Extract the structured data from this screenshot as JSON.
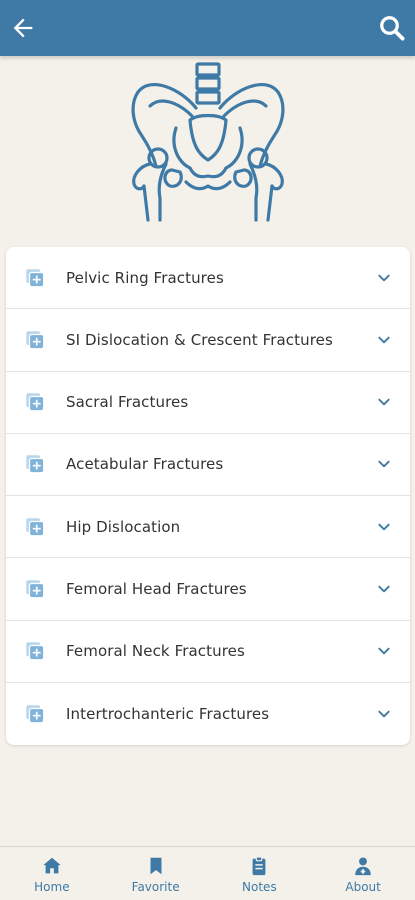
{
  "colors": {
    "primary": "#3f7aa6",
    "background": "#f4f1ea",
    "card": "#ffffff",
    "icon_light_blue": "#7fb3d9",
    "text": "#333333"
  },
  "topbar": {
    "back_icon": "arrow-left-icon",
    "search_icon": "search-icon"
  },
  "hero": {
    "icon": "pelvis-icon"
  },
  "sections": [
    {
      "label": "Pelvic Ring Fractures",
      "icon": "add-file-icon",
      "chevron": "chevron-down-icon"
    },
    {
      "label": "SI Dislocation & Crescent Fractures",
      "icon": "add-file-icon",
      "chevron": "chevron-down-icon"
    },
    {
      "label": "Sacral Fractures",
      "icon": "add-file-icon",
      "chevron": "chevron-down-icon"
    },
    {
      "label": "Acetabular Fractures",
      "icon": "add-file-icon",
      "chevron": "chevron-down-icon"
    },
    {
      "label": "Hip Dislocation",
      "icon": "add-file-icon",
      "chevron": "chevron-down-icon"
    },
    {
      "label": "Femoral Head Fractures",
      "icon": "add-file-icon",
      "chevron": "chevron-down-icon"
    },
    {
      "label": "Femoral Neck Fractures",
      "icon": "add-file-icon",
      "chevron": "chevron-down-icon"
    },
    {
      "label": "Intertrochanteric Fractures",
      "icon": "add-file-icon",
      "chevron": "chevron-down-icon"
    }
  ],
  "bottom_nav": [
    {
      "label": "Home",
      "icon": "home-icon"
    },
    {
      "label": "Favorite",
      "icon": "bookmark-icon"
    },
    {
      "label": "Notes",
      "icon": "clipboard-icon"
    },
    {
      "label": "About",
      "icon": "doctor-icon"
    }
  ]
}
